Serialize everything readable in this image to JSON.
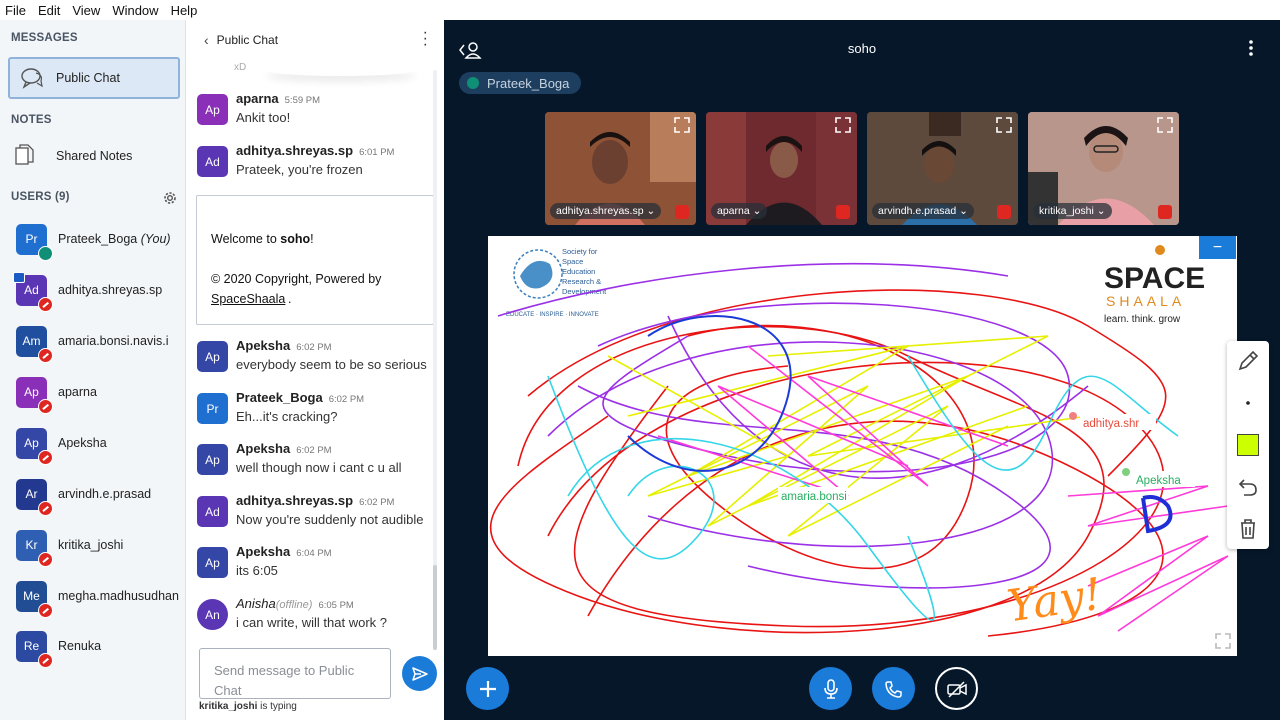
{
  "menu": [
    "File",
    "Edit",
    "View",
    "Window",
    "Help"
  ],
  "left": {
    "messages_title": "MESSAGES",
    "public_chat": "Public Chat",
    "notes_title": "NOTES",
    "shared_notes": "Shared Notes",
    "users_title": "USERS (9)",
    "users": [
      {
        "initials": "Pr",
        "name": "Prateek_Boga",
        "you": "(You)",
        "color": "#1e6fcf"
      },
      {
        "initials": "Ad",
        "name": "adhitya.shreyas.sp",
        "color": "#5a35b4"
      },
      {
        "initials": "Am",
        "name": "amaria.bonsi.navis.i",
        "color": "#1f4f9e"
      },
      {
        "initials": "Ap",
        "name": "aparna",
        "color": "#8a2fb8"
      },
      {
        "initials": "Ap",
        "name": "Apeksha",
        "color": "#3446a6"
      },
      {
        "initials": "Ar",
        "name": "arvindh.e.prasad",
        "color": "#23398f"
      },
      {
        "initials": "Kr",
        "name": "kritika_joshi",
        "color": "#2f5fb3"
      },
      {
        "initials": "Me",
        "name": "megha.madhusudhan",
        "color": "#214d95"
      },
      {
        "initials": "Re",
        "name": "Renuka",
        "color": "#2d4aa2"
      }
    ]
  },
  "chat": {
    "title": "Public Chat",
    "faded_text": "xD",
    "messages_top": [
      {
        "initials": "Ap",
        "name": "aparna",
        "time": "5:59 PM",
        "text": "Ankit too!",
        "color": "#8a2fb8"
      },
      {
        "initials": "Ad",
        "name": "adhitya.shreyas.sp",
        "time": "6:01 PM",
        "text": "Prateek, you're frozen",
        "color": "#5a35b4"
      }
    ],
    "welcome": {
      "line1_prefix": "Welcome to ",
      "line1_bold": "soho",
      "line1_suffix": "!",
      "line2": "© 2020 Copyright, Powered by",
      "line3": "SpaceShaala",
      "line3_suffix": "."
    },
    "messages": [
      {
        "initials": "Ap",
        "name": "Apeksha",
        "time": "6:02 PM",
        "text": "everybody seem to be so serious",
        "color": "#3446a6"
      },
      {
        "initials": "Pr",
        "name": "Prateek_Boga",
        "time": "6:02 PM",
        "text": "Eh...it's cracking?",
        "color": "#1e6fcf"
      },
      {
        "initials": "Ap",
        "name": "Apeksha",
        "time": "6:02 PM",
        "text": "well though now i cant c u all",
        "color": "#3446a6"
      },
      {
        "initials": "Ad",
        "name": "adhitya.shreyas.sp",
        "time": "6:02 PM",
        "text": "Now you're suddenly not audible",
        "color": "#5a35b4"
      },
      {
        "initials": "Ap",
        "name": "Apeksha",
        "time": "6:04 PM",
        "text": "its 6:05",
        "color": "#3446a6"
      }
    ],
    "last": {
      "initials": "An",
      "name": "Anisha",
      "status": "(offline)",
      "time": "6:05 PM",
      "text": "i can write, will that work ?",
      "color": "#5a35b4"
    },
    "input_placeholder": "Send message to Public Chat",
    "typing_user": "kritika_joshi",
    "typing_suffix": " is typing"
  },
  "meeting": {
    "title": "soho",
    "presenter": "Prateek_Boga",
    "videos": [
      {
        "name": "adhitya.shreyas.sp",
        "bg": "#8a4a32",
        "skin": "#6b4030"
      },
      {
        "name": "aparna",
        "bg": "#6e2a2e",
        "skin": "#8a5a48"
      },
      {
        "name": "arvindh.e.prasad",
        "bg": "#5a4638",
        "skin": "#6a4836"
      },
      {
        "name": "kritika_joshi",
        "bg": "#b08a80",
        "skin": "#b58a78"
      }
    ],
    "whiteboard": {
      "logo_sser": [
        "Society for",
        "Space",
        "Education",
        "Research &",
        "Development"
      ],
      "logo_sser_tag": "EDUCATE · INSPIRE · INNOVATE",
      "logo_space": "SPACE",
      "logo_shaala": "SHAALA",
      "logo_tagline": "learn. think. grow",
      "cursor_labels": [
        {
          "name": "adhitya.shr",
          "color": "#e74c3c"
        },
        {
          "name": "Apeksha",
          "color": "#27ae60"
        },
        {
          "name": "amaria.bonsi",
          "color": "#27ae60"
        }
      ],
      "doodle_text": "Yay!",
      "accent_color": "#ccff00"
    }
  }
}
